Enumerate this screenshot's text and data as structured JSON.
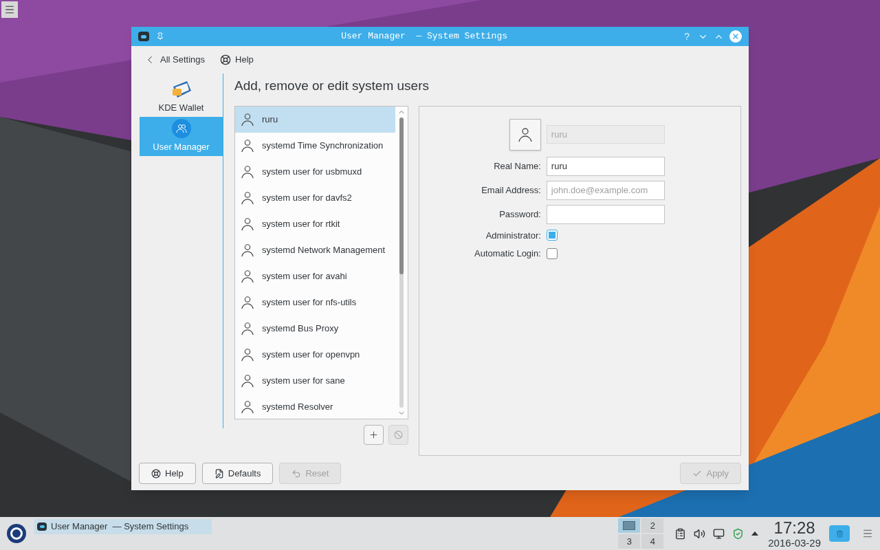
{
  "window": {
    "title": "User Manager  — System Settings",
    "help_glyph": "?"
  },
  "toolbar": [
    {
      "label": "All Settings",
      "kind": "back"
    },
    {
      "label": "Help",
      "kind": "help"
    }
  ],
  "sidebar": {
    "items": [
      {
        "label": "KDE Wallet",
        "selected": false,
        "kind": "wallet"
      },
      {
        "label": "User Manager",
        "selected": true,
        "kind": "users"
      }
    ]
  },
  "heading": "Add, remove or edit system users",
  "users": [
    {
      "name": "ruru",
      "selected": true
    },
    {
      "name": "systemd Time Synchronization",
      "selected": false
    },
    {
      "name": "system user for usbmuxd",
      "selected": false
    },
    {
      "name": "system user for davfs2",
      "selected": false
    },
    {
      "name": "system user for rtkit",
      "selected": false
    },
    {
      "name": "systemd Network Management",
      "selected": false
    },
    {
      "name": "system user for avahi",
      "selected": false
    },
    {
      "name": "system user for nfs-utils",
      "selected": false
    },
    {
      "name": "systemd Bus Proxy",
      "selected": false
    },
    {
      "name": "system user for openvpn",
      "selected": false
    },
    {
      "name": "system user for sane",
      "selected": false
    },
    {
      "name": "systemd Resolver",
      "selected": false
    }
  ],
  "list_buttons": [
    {
      "kind": "add",
      "disabled": false
    },
    {
      "kind": "remove",
      "disabled": true
    }
  ],
  "form": {
    "username": {
      "value": "ruru",
      "disabled": true
    },
    "fields": [
      {
        "label": "Real Name:",
        "value": "ruru"
      },
      {
        "label": "Email Address:",
        "placeholder": "john.doe@example.com"
      },
      {
        "label": "Password:"
      }
    ],
    "checkboxes": [
      {
        "label": "Administrator:",
        "checked": true
      },
      {
        "label": "Automatic Login:",
        "checked": false
      }
    ]
  },
  "buttons": [
    {
      "label": "Help",
      "kind": "help",
      "disabled": false
    },
    {
      "label": "Defaults",
      "kind": "defaults",
      "disabled": false
    },
    {
      "label": "Reset",
      "kind": "reset",
      "disabled": true
    },
    {
      "label": "Apply",
      "kind": "apply",
      "disabled": true
    }
  ],
  "taskbar": {
    "tasks": [
      {
        "label": "User Manager  — System Settings",
        "selected": true
      }
    ],
    "pager": [
      {
        "selected": true
      },
      {
        "label": "2",
        "selected": false
      },
      {
        "label": "3",
        "selected": false
      },
      {
        "label": "4",
        "selected": false
      }
    ],
    "clock": {
      "time": "17:28",
      "date": "2016-03-29"
    }
  }
}
